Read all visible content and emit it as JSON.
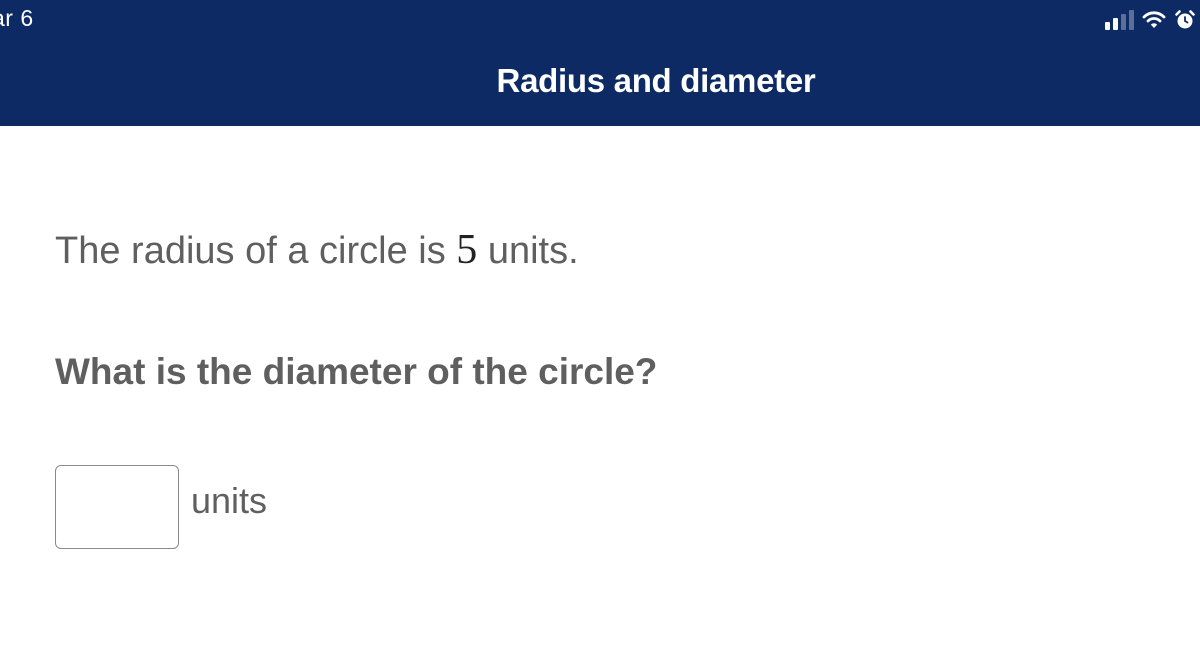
{
  "status_bar": {
    "time": "ar 6",
    "signal_icon": "cellular-signal-icon",
    "wifi_icon": "wifi-icon",
    "alarm_icon": "alarm-clock-icon"
  },
  "header": {
    "title": "Radius and diameter",
    "background_color": "#0d2a64"
  },
  "problem": {
    "statement_prefix": "The radius of a circle is ",
    "radius_value": "5",
    "statement_suffix": " units.",
    "question": "What is the diameter of the circle?"
  },
  "answer": {
    "value": "",
    "placeholder": "",
    "unit": "units"
  }
}
